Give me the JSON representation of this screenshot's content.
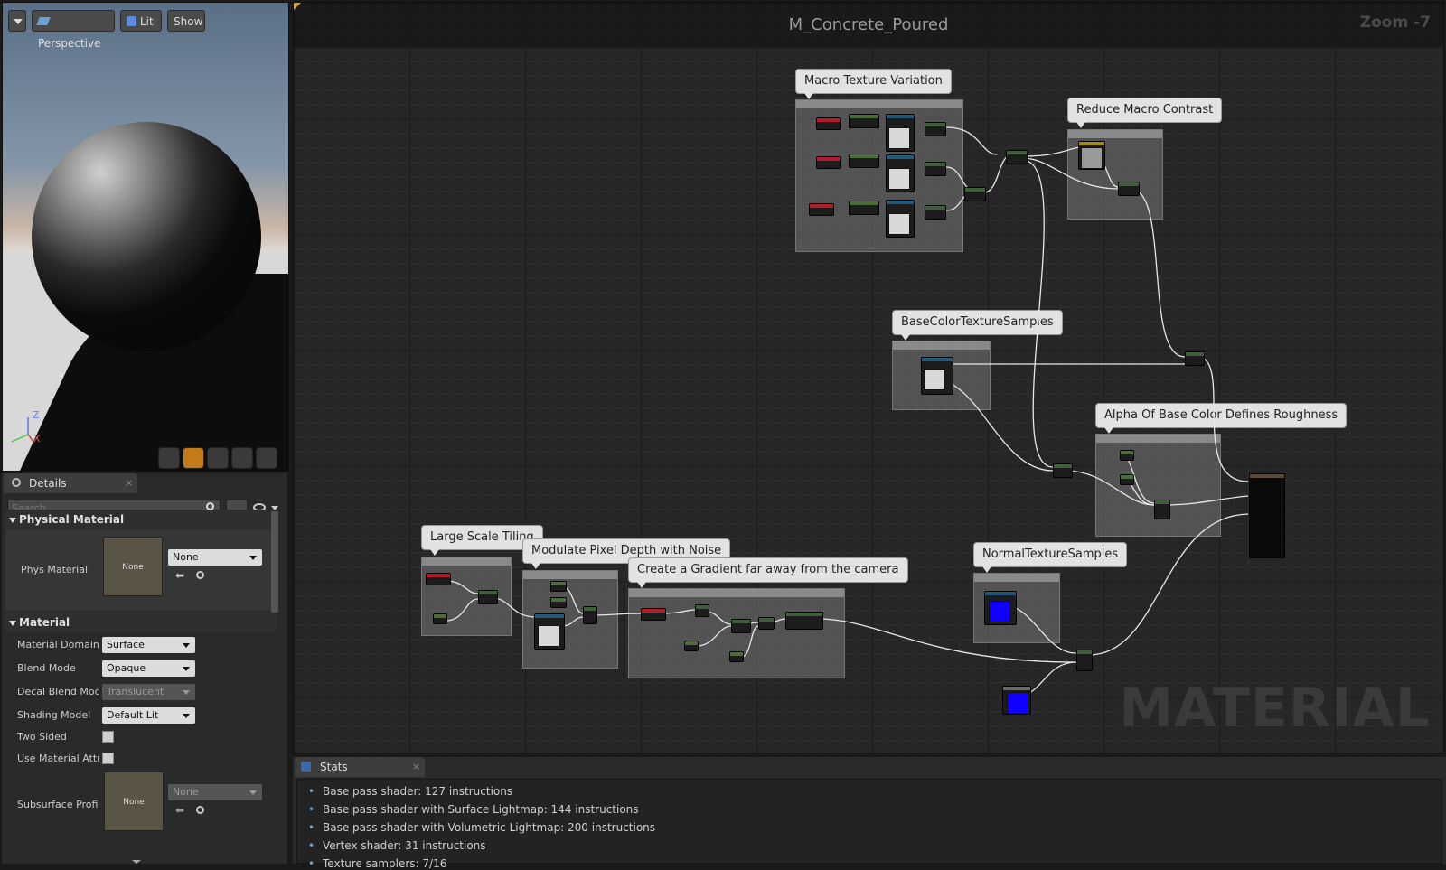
{
  "viewport": {
    "perspective_label": "Perspective",
    "lit_label": "Lit",
    "show_label": "Show",
    "axis_z": "Z",
    "axis_x": "X"
  },
  "details": {
    "tab_label": "Details",
    "search_placeholder": "Search",
    "physical_material": {
      "heading": "Physical Material",
      "phys_material_label": "Phys Material",
      "thumb_text": "None",
      "combo_value": "None"
    },
    "material": {
      "heading": "Material",
      "rows": [
        {
          "label": "Material Domain",
          "value": "Surface"
        },
        {
          "label": "Blend Mode",
          "value": "Opaque"
        },
        {
          "label": "Decal Blend Mode",
          "value": "Translucent"
        },
        {
          "label": "Shading Model",
          "value": "Default Lit"
        }
      ],
      "two_sided_label": "Two Sided",
      "use_material_attr_label": "Use Material Attri",
      "subsurface_label": "Subsurface Profil",
      "subsurface_thumb_text": "None",
      "subsurface_combo_value": "None"
    }
  },
  "graph": {
    "title": "M_Concrete_Poured",
    "zoom": "Zoom -7",
    "watermark": "MATERIAL",
    "comments": [
      "Macro Texture Variation",
      "Reduce Macro Contrast",
      "BaseColorTextureSamples",
      "Alpha Of Base Color Defines Roughness",
      "Large Scale Tiling",
      "Modulate Pixel Depth with Noise",
      "Create a Gradient far away from the camera",
      "NormalTextureSamples"
    ]
  },
  "stats": {
    "tab_label": "Stats",
    "lines": [
      "Base pass shader: 127 instructions",
      "Base pass shader with Surface Lightmap: 144 instructions",
      "Base pass shader with Volumetric Lightmap: 200 instructions",
      "Vertex shader: 31 instructions",
      "Texture samplers: 7/16"
    ]
  },
  "colors": {
    "accent_blue": "#1100ff",
    "panel_bg": "#2a2a2a",
    "graph_bg": "#262626"
  }
}
